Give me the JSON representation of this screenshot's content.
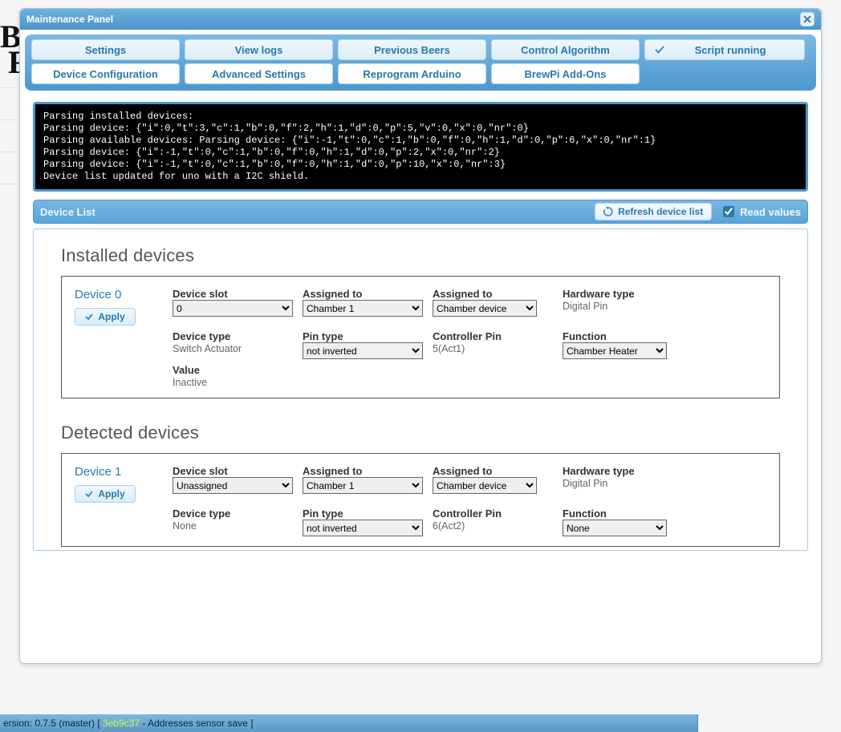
{
  "window": {
    "title": "Maintenance Panel"
  },
  "tabs1": {
    "settings": "Settings",
    "viewlogs": "View logs",
    "prevbeers": "Previous Beers",
    "control": "Control Algorithm",
    "scriptrunning": "Script running"
  },
  "tabs2": {
    "devconfig": "Device Configuration",
    "advsettings": "Advanced Settings",
    "reprogram": "Reprogram Arduino",
    "addons": "BrewPi Add-Ons"
  },
  "console_text": "Parsing installed devices:\nParsing device: {\"i\":0,\"t\":3,\"c\":1,\"b\":0,\"f\":2,\"h\":1,\"d\":0,\"p\":5,\"v\":0,\"x\":0,\"nr\":0}\nParsing available devices: Parsing device: {\"i\":-1,\"t\":0,\"c\":1,\"b\":0,\"f\":0,\"h\":1,\"d\":0,\"p\":6,\"x\":0,\"nr\":1}\nParsing device: {\"i\":-1,\"t\":0,\"c\":1,\"b\":0,\"f\":0,\"h\":1,\"d\":0,\"p\":2,\"x\":0,\"nr\":2}\nParsing device: {\"i\":-1,\"t\":0,\"c\":1,\"b\":0,\"f\":0,\"h\":1,\"d\":0,\"p\":10,\"x\":0,\"nr\":3}\nDevice list updated for uno with a I2C shield.",
  "device_list": {
    "title": "Device List",
    "refresh": "Refresh device list",
    "readvalues": "Read values"
  },
  "headings": {
    "installed": "Installed devices",
    "detected": "Detected devices"
  },
  "labels": {
    "device_slot": "Device slot",
    "assigned_to": "Assigned to",
    "hardware_type": "Hardware type",
    "device_type": "Device type",
    "pin_type": "Pin type",
    "controller_pin": "Controller Pin",
    "function": "Function",
    "value": "Value",
    "apply": "Apply"
  },
  "options": {
    "slots_0": "0",
    "slots_unassigned": "Unassigned",
    "chamber1": "Chamber 1",
    "chamber_device": "Chamber device",
    "not_inverted": "not inverted",
    "chamber_heater": "Chamber Heater",
    "none": "None"
  },
  "devices": {
    "d0": {
      "name": "Device 0",
      "slot": "0",
      "assigned_to_chamber": "Chamber 1",
      "assigned_to_device": "Chamber device",
      "hardware_type": "Digital Pin",
      "device_type": "Switch Actuator",
      "pin_type": "not inverted",
      "controller_pin": "5(Act1)",
      "function": "Chamber Heater",
      "value": "Inactive"
    },
    "d1": {
      "name": "Device 1",
      "slot": "Unassigned",
      "assigned_to_chamber": "Chamber 1",
      "assigned_to_device": "Chamber device",
      "hardware_type": "Digital Pin",
      "device_type": "None",
      "pin_type": "not inverted",
      "controller_pin": "6(Act2)",
      "function": "None"
    }
  },
  "footer": {
    "prefix": "ersion: 0.7.5 (master) [ ",
    "hash": "3eb9c37",
    "suffix": " - Addresses sensor save ]"
  }
}
